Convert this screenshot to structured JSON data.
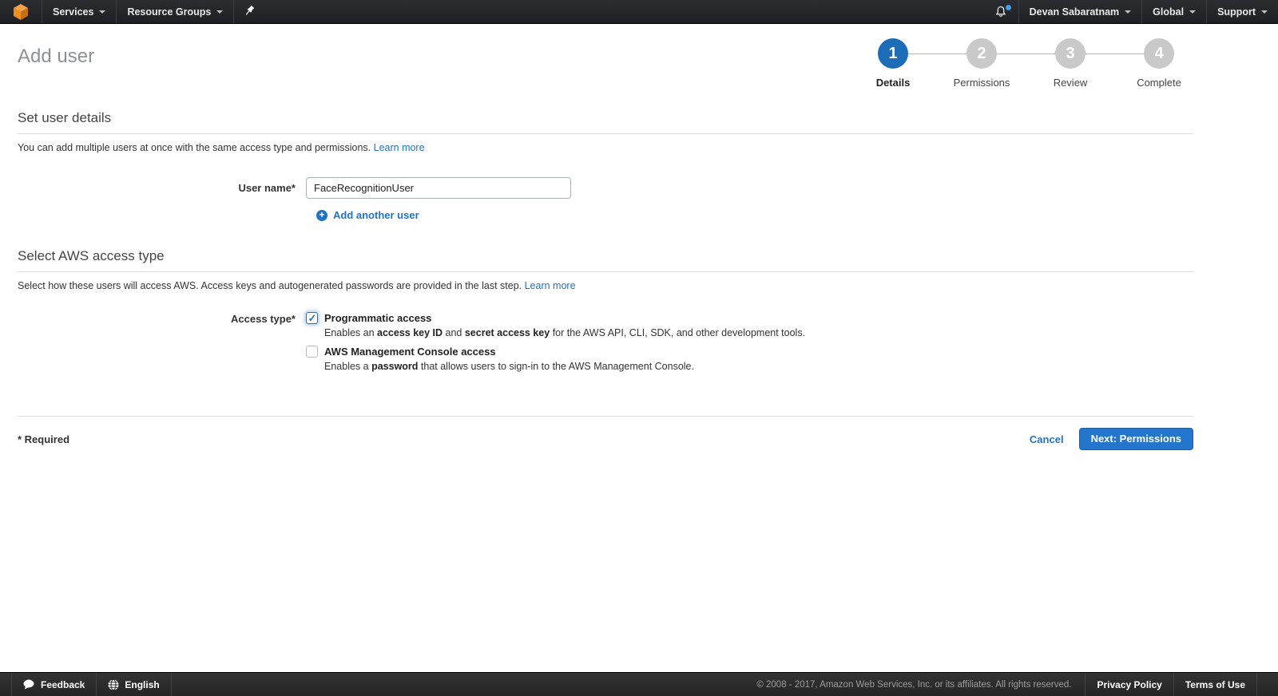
{
  "colors": {
    "nav_bg": "#232528",
    "footer_bg": "#2b2b2b",
    "aws_orange": "#ec912d",
    "accent_blue": "#2173c4",
    "active_step_blue": "#1c6cb8",
    "inactive_step_gray": "#c9c9c9",
    "notification_dot_blue": "#3f9ff0"
  },
  "topnav": {
    "services_label": "Services",
    "resource_groups_label": "Resource Groups",
    "account_name": "Devan Sabaratnam",
    "region_label": "Global",
    "support_label": "Support"
  },
  "header": {
    "title": "Add user",
    "steps": [
      {
        "number": "1",
        "label": "Details",
        "active": true
      },
      {
        "number": "2",
        "label": "Permissions",
        "active": false
      },
      {
        "number": "3",
        "label": "Review",
        "active": false
      },
      {
        "number": "4",
        "label": "Complete",
        "active": false
      }
    ]
  },
  "user_details": {
    "heading": "Set user details",
    "description": "You can add multiple users at once with the same access type and permissions.",
    "learn_more": "Learn more",
    "username_label": "User name*",
    "username_value": "FaceRecognitionUser",
    "add_another": "Add another user"
  },
  "access_type": {
    "heading": "Select AWS access type",
    "description": "Select how these users will access AWS. Access keys and autogenerated passwords are provided in the last step.",
    "learn_more": "Learn more",
    "field_label": "Access type*",
    "options": [
      {
        "title": "Programmatic access",
        "checked": true,
        "desc_parts": [
          "Enables an ",
          "access key ID",
          " and ",
          "secret access key",
          " for the AWS API, CLI, SDK, and other development tools."
        ]
      },
      {
        "title": "AWS Management Console access",
        "checked": false,
        "desc_parts": [
          "Enables a ",
          "password",
          " that allows users to sign-in to the AWS Management Console."
        ]
      }
    ]
  },
  "actions": {
    "required_note": "* Required",
    "cancel_label": "Cancel",
    "next_label": "Next: Permissions"
  },
  "footer": {
    "feedback_label": "Feedback",
    "language_label": "English",
    "copyright": "© 2008 - 2017, Amazon Web Services, Inc. or its affiliates. All rights reserved.",
    "privacy_label": "Privacy Policy",
    "terms_label": "Terms of Use"
  }
}
